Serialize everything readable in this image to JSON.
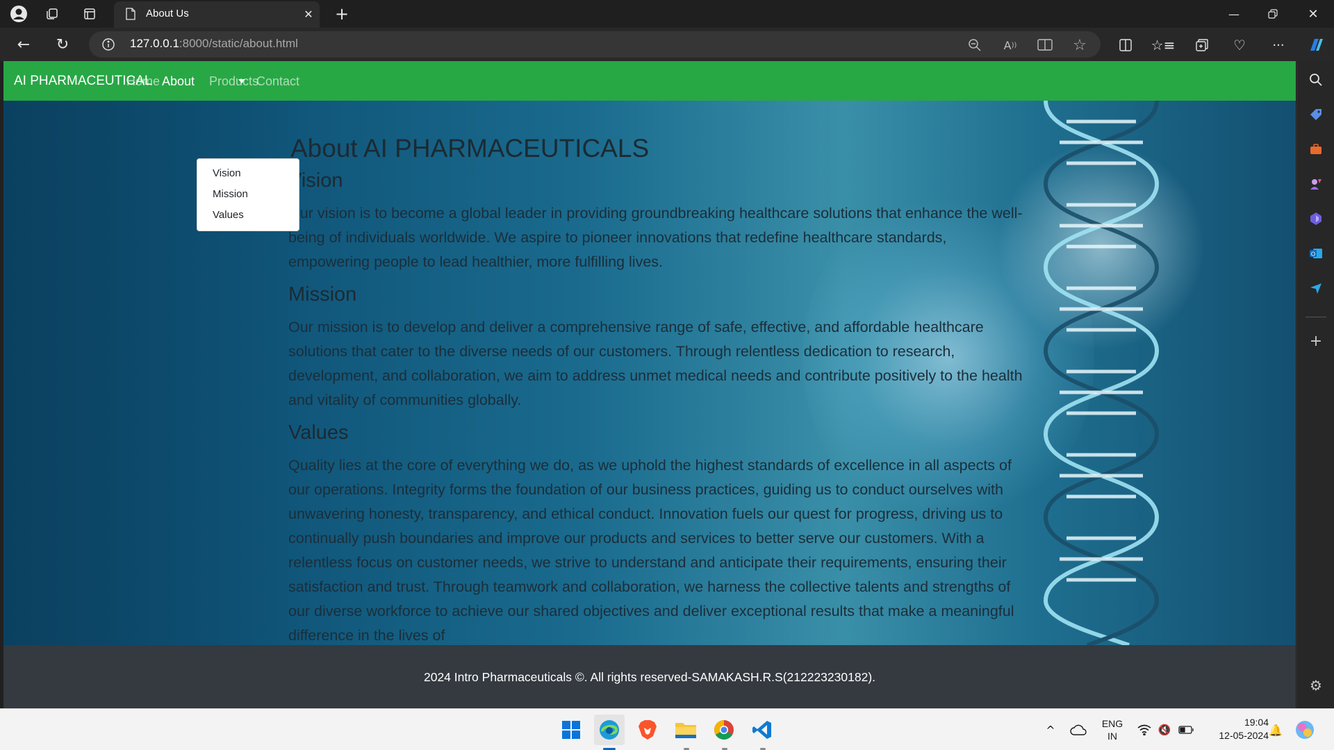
{
  "browser": {
    "tab_title": "About Us",
    "url_host": "127.0.0.1",
    "url_path": ":8000/static/about.html"
  },
  "navbar": {
    "brand": "AI PHARMACEUTICAL",
    "links": [
      "Home",
      "About",
      "Products",
      "Contact"
    ]
  },
  "dropdown": {
    "items": [
      "Vision",
      "Mission",
      "Values"
    ]
  },
  "page": {
    "title": "About AI PHARMACEUTICALS",
    "vision_heading": "Vision",
    "vision_text": "Our vision is to become a global leader in providing groundbreaking healthcare solutions that enhance the well-being of individuals worldwide. We aspire to pioneer innovations that redefine healthcare standards, empowering people to lead healthier, more fulfilling lives.",
    "mission_heading": "Mission",
    "mission_text": "Our mission is to develop and deliver a comprehensive range of safe, effective, and affordable healthcare solutions that cater to the diverse needs of our customers. Through relentless dedication to research, development, and collaboration, we aim to address unmet medical needs and contribute positively to the health and vitality of communities globally.",
    "values_heading": "Values",
    "values_text": "Quality lies at the core of everything we do, as we uphold the highest standards of excellence in all aspects of our operations. Integrity forms the foundation of our business practices, guiding us to conduct ourselves with unwavering honesty, transparency, and ethical conduct. Innovation fuels our quest for progress, driving us to continually push boundaries and improve our products and services to better serve our customers. With a relentless focus on customer needs, we strive to understand and anticipate their requirements, ensuring their satisfaction and trust. Through teamwork and collaboration, we harness the collective talents and strengths of our diverse workforce to achieve our shared objectives and deliver exceptional results that make a meaningful difference in the lives of"
  },
  "footer": {
    "text": "2024 Intro Pharmaceuticals ©. All rights reserved-SAMAKASH.R.S(212223230182)."
  },
  "taskbar": {
    "lang_top": "ENG",
    "lang_bottom": "IN",
    "time": "19:04",
    "date": "12-05-2024"
  },
  "colors": {
    "navbar": "#28a745",
    "footer": "#343a40"
  }
}
